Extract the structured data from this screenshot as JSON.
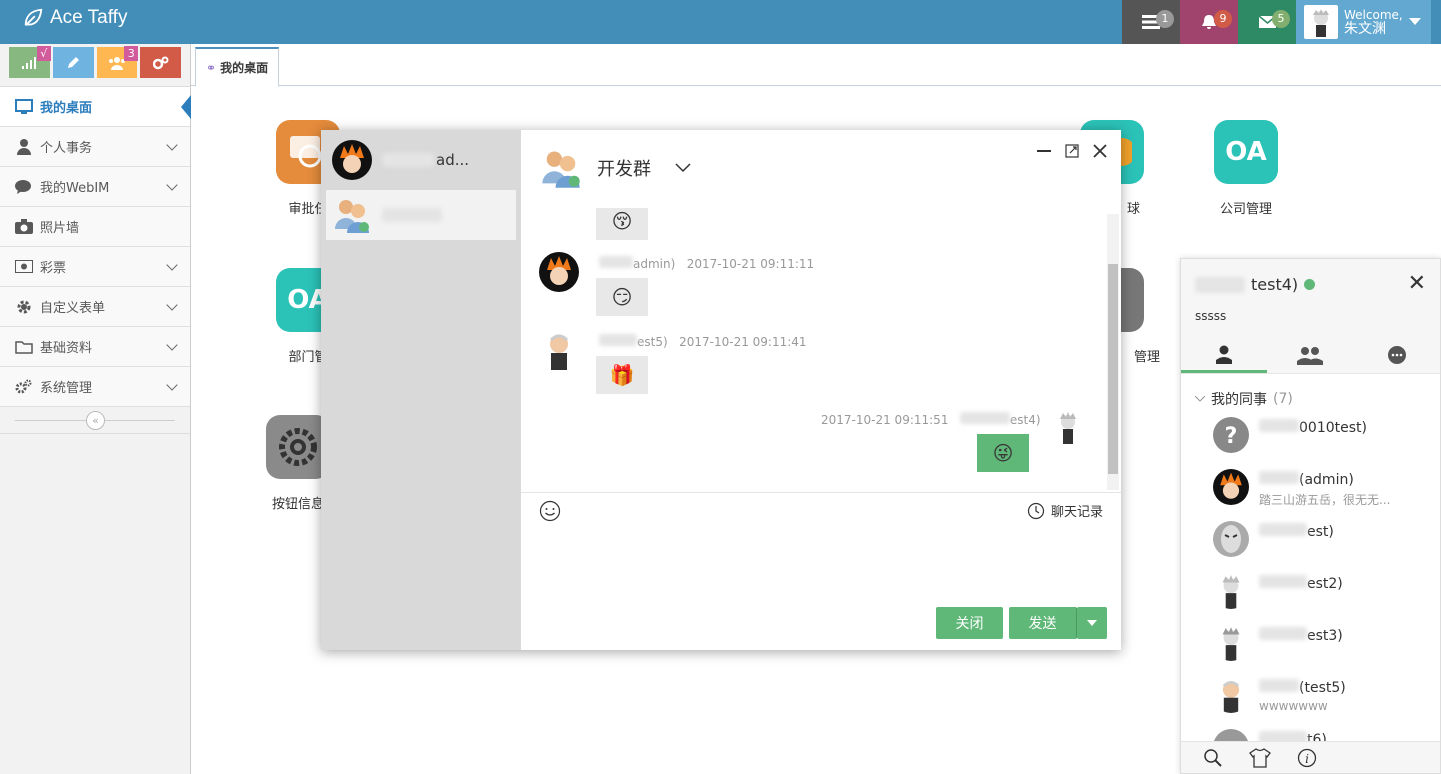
{
  "brand": {
    "name": "Ace Taffy"
  },
  "navbar": {
    "tasks_badge": "1",
    "notifications_badge": "9",
    "messages_badge": "5",
    "user_welcome": "Welcome,",
    "user_name": "朱文渊"
  },
  "shortcuts": {
    "success_badge": "√",
    "team_badge": "3"
  },
  "sidebar": {
    "items": [
      {
        "label": "我的桌面"
      },
      {
        "label": "个人事务"
      },
      {
        "label": "我的WebIM"
      },
      {
        "label": "照片墙"
      },
      {
        "label": "彩票"
      },
      {
        "label": "自定义表单"
      },
      {
        "label": "基础资料"
      },
      {
        "label": "系统管理"
      }
    ],
    "collapse_glyph": "«"
  },
  "tabs": [
    {
      "label": "我的桌面"
    }
  ],
  "desktop": {
    "apps": [
      {
        "label": "审批任",
        "color": "#e48b3c"
      },
      {
        "label": "部门管",
        "color": "#2bc2b8"
      },
      {
        "label": "按钮信息",
        "color": "#8a8a8a"
      },
      {
        "label": "球",
        "color": "#f0a12b"
      },
      {
        "label": "公司管理",
        "color": "#2bc2b8"
      },
      {
        "label": "管理",
        "color": "#777777"
      }
    ],
    "oa_text": "OA"
  },
  "chat": {
    "list": [
      {
        "name": "ad..."
      },
      {
        "name": "..."
      }
    ],
    "title": "开发群",
    "messages": [
      {
        "sender": "admin)",
        "time": "2017-10-21 09:11:11",
        "emoji": "😏"
      },
      {
        "sender": "est5)",
        "time": "2017-10-21 09:11:41",
        "emoji": "🎁"
      },
      {
        "sender": "est4)",
        "time": "2017-10-21 09:11:51",
        "emoji": "😜"
      }
    ],
    "history_label": "聊天记录",
    "close_label": "关闭",
    "send_label": "发送"
  },
  "panel": {
    "user_name": "test4)",
    "signature": "sssss",
    "group_name": "我的同事",
    "group_count": "(7)",
    "friends": [
      {
        "name": "0010test)",
        "sign": ""
      },
      {
        "name": "(admin)",
        "sign": "踏三山游五岳，很无无..."
      },
      {
        "name": "est)",
        "sign": ""
      },
      {
        "name": "est2)",
        "sign": ""
      },
      {
        "name": "est3)",
        "sign": ""
      },
      {
        "name": "(test5)",
        "sign": "wwwwwww"
      },
      {
        "name": "t6)",
        "sign": ""
      }
    ]
  },
  "colors": {
    "navbar": "#438eb9",
    "tasks": "#555555",
    "notifications": "#a0446e",
    "messages": "#2e8965",
    "user": "#62a8d1",
    "chat_green": "#5fb878"
  }
}
